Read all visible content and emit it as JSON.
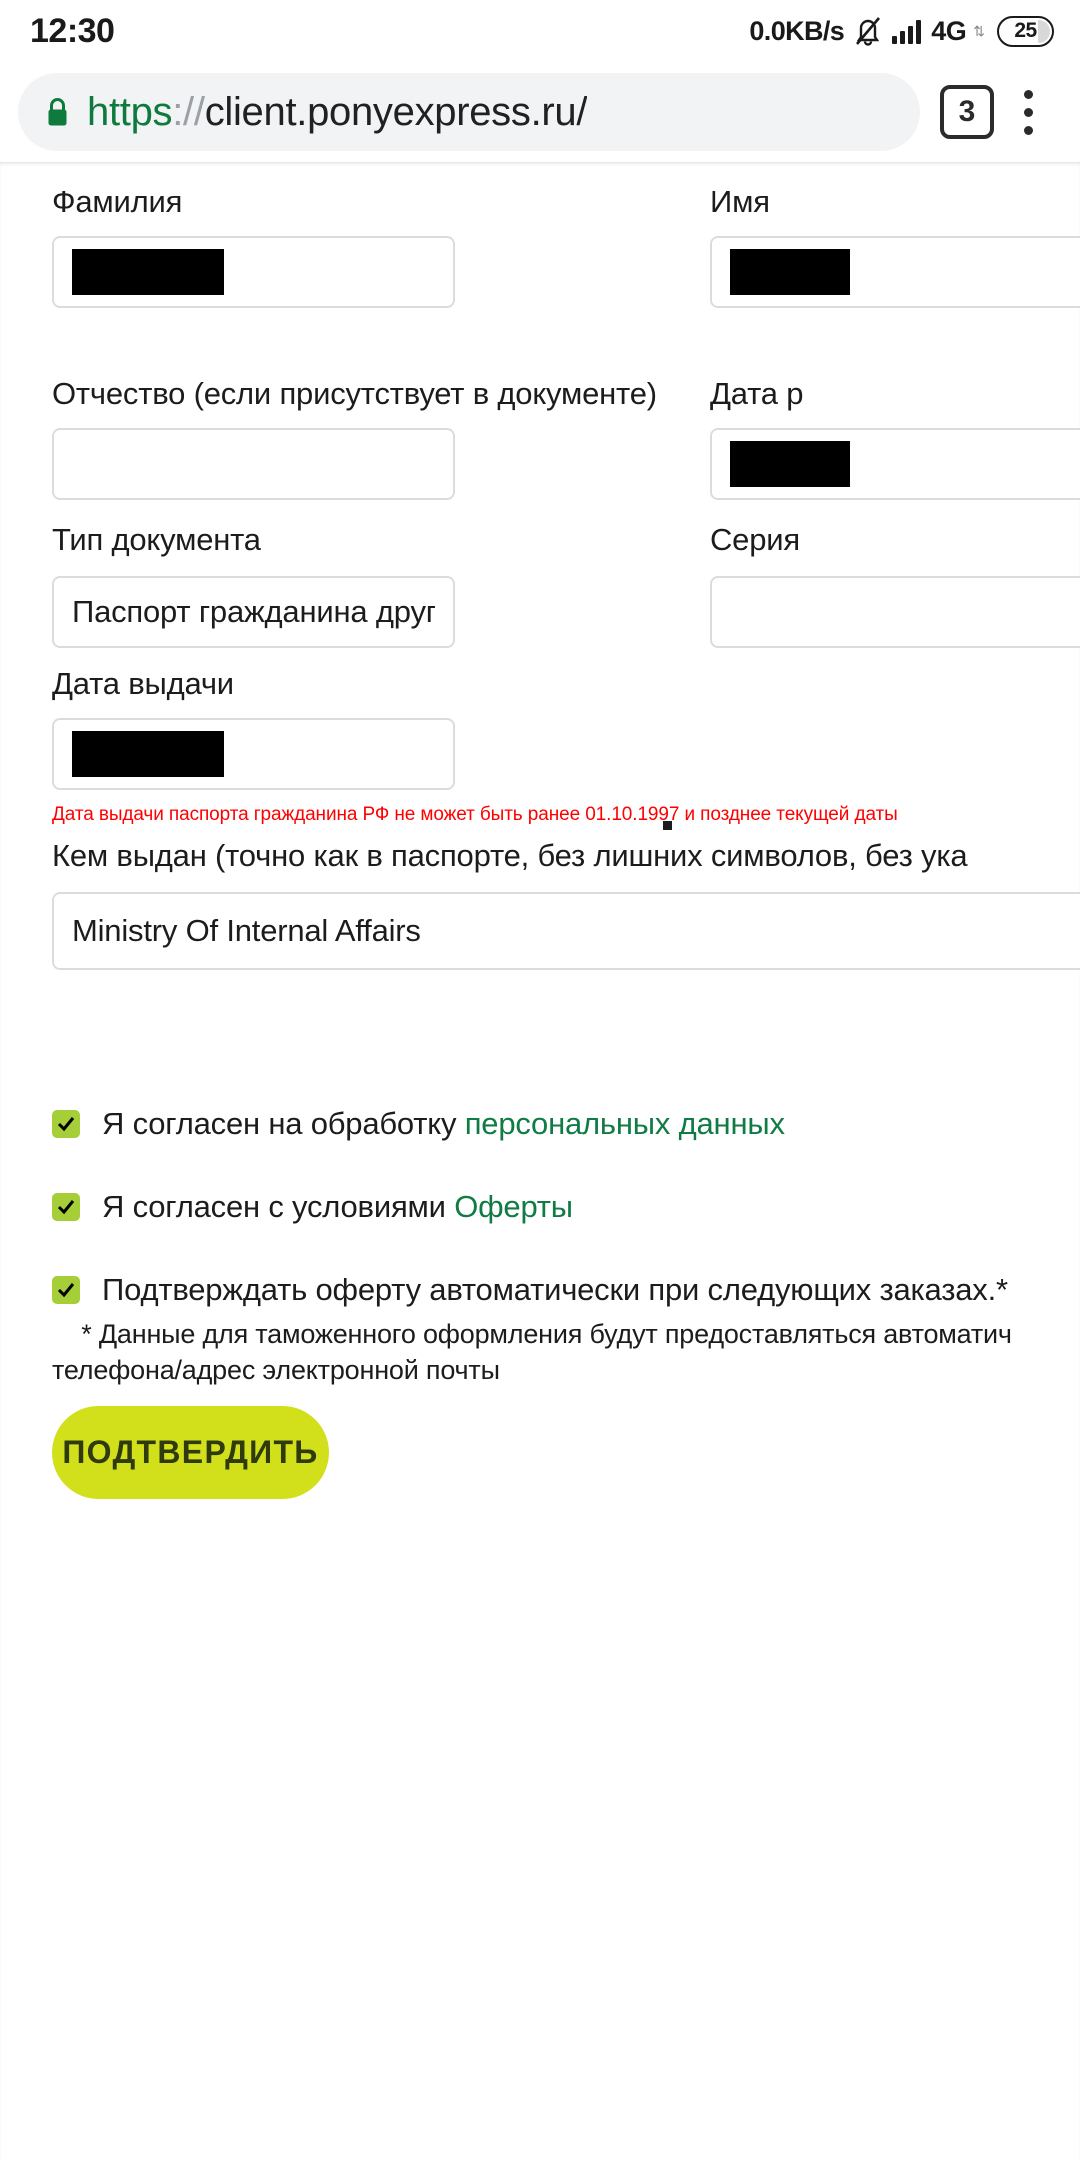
{
  "status_bar": {
    "time": "12:30",
    "network_speed": "0.0KB/s",
    "bell_icon": "bell-muted-icon",
    "signal_icon": "signal-bars-icon",
    "network_type": "4G",
    "data_arrows": "⇅",
    "battery_level": "25"
  },
  "browser": {
    "lock_icon": "lock-icon",
    "url_scheme": "https",
    "url_separator": "://",
    "url_host": "client.ponyexpress.ru/",
    "tab_count": "3",
    "menu_icon": "kebab-menu-icon"
  },
  "form": {
    "surname": {
      "label": "Фамилия",
      "value": ""
    },
    "firstname": {
      "label": "Имя",
      "value": ""
    },
    "patronymic": {
      "label": "Отчество (если присутствует в документе)",
      "value": ""
    },
    "birthdate": {
      "label": "Дата р",
      "value": ""
    },
    "doctype": {
      "label": "Тип документа",
      "value": "Паспорт гражданина другог…"
    },
    "series": {
      "label": "Серия",
      "value": ""
    },
    "issuedate": {
      "label": "Дата выдачи",
      "value": "",
      "error": "Дата выдачи паспорта гражданина РФ не может быть ранее 01.10.1997 и позднее текущей даты"
    },
    "issuedby": {
      "label": "Кем выдан (точно как в паспорте, без лишних символов, без ука",
      "value": "Ministry Of Internal Affairs"
    }
  },
  "agreements": {
    "personal_data": {
      "text": "Я согласен на обработку ",
      "link": "персональных данных",
      "checked": true
    },
    "offer": {
      "text": "Я согласен с условиями ",
      "link": "Оферты",
      "checked": true
    },
    "auto_offer": {
      "text": "Подтверждать оферту автоматически при следующих заказах.*",
      "checked": true
    },
    "footnote": "    * Данные для таможенного оформления будут предоставляться автоматич\nтелефона/адрес электронной почты"
  },
  "submit": {
    "label": "ПОДТВЕРДИТЬ"
  },
  "colors": {
    "accent_green": "#107b45",
    "checkbox_green": "#a6ce39",
    "submit_yellow": "#d2e01b",
    "error_red": "#ff0000"
  }
}
